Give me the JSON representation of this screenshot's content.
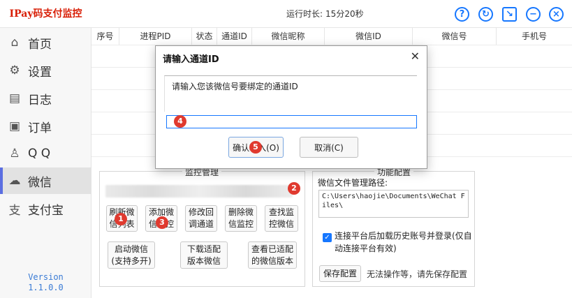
{
  "app": {
    "title": "IPay码支付监控",
    "runtime_label": "运行时长:",
    "runtime_value": "15分20秒"
  },
  "titlebar_icons": [
    "help-icon",
    "refresh-icon",
    "minimize-to-tray-icon",
    "minimize-icon",
    "close-icon"
  ],
  "sidebar": {
    "items": [
      {
        "label": "首页",
        "icon": "home-icon"
      },
      {
        "label": "设置",
        "icon": "gear-icon"
      },
      {
        "label": "日志",
        "icon": "clipboard-icon"
      },
      {
        "label": "订单",
        "icon": "order-search-icon"
      },
      {
        "label": "Q Q",
        "icon": "qq-icon"
      },
      {
        "label": "微信",
        "icon": "wechat-icon"
      },
      {
        "label": "支付宝",
        "icon": "alipay-icon"
      }
    ],
    "active_index": 5,
    "version_line1": "Version",
    "version_line2": "1.1.0.0"
  },
  "table": {
    "columns": [
      "序号",
      "进程PID",
      "状态",
      "通道ID",
      "微信昵称",
      "微信ID",
      "微信号",
      "手机号"
    ]
  },
  "monitor_panel": {
    "title": "监控管理",
    "buttons": [
      {
        "label": "刷新微\n信列表"
      },
      {
        "label": "添加微\n信监控"
      },
      {
        "label": "修改回\n调通道"
      },
      {
        "label": "删除微\n信监控"
      },
      {
        "label": "查找监\n控微信"
      },
      {
        "label": "启动微信\n(支持多开)"
      },
      {
        "label": "下载适配\n版本微信"
      },
      {
        "label": "查看已适配\n的微信版本"
      }
    ]
  },
  "config_panel": {
    "title": "功能配置",
    "path_label": "微信文件管理路径:",
    "path_value": "C:\\Users\\haojie\\Documents\\WeChat Files\\",
    "checkbox_label": "连接平台后加载历史账号并登录(仅自动连接平台有效)",
    "checkbox_checked": true,
    "save_button": "保存配置",
    "hint": "无法操作等，请先保存配置"
  },
  "dialog": {
    "title": "请输入通道ID",
    "close_label": "✕",
    "prompt": "请输入您该微信号要绑定的通道ID",
    "input_value": "",
    "ok_label": "确认输入(O)",
    "cancel_label": "取消(C)"
  },
  "badges": [
    "1",
    "2",
    "3",
    "4",
    "5"
  ],
  "colors": {
    "accent": "#1677ff",
    "title_red": "#d81e06",
    "badge_red": "#e03a2f",
    "active_marker": "#5b6ee1"
  }
}
